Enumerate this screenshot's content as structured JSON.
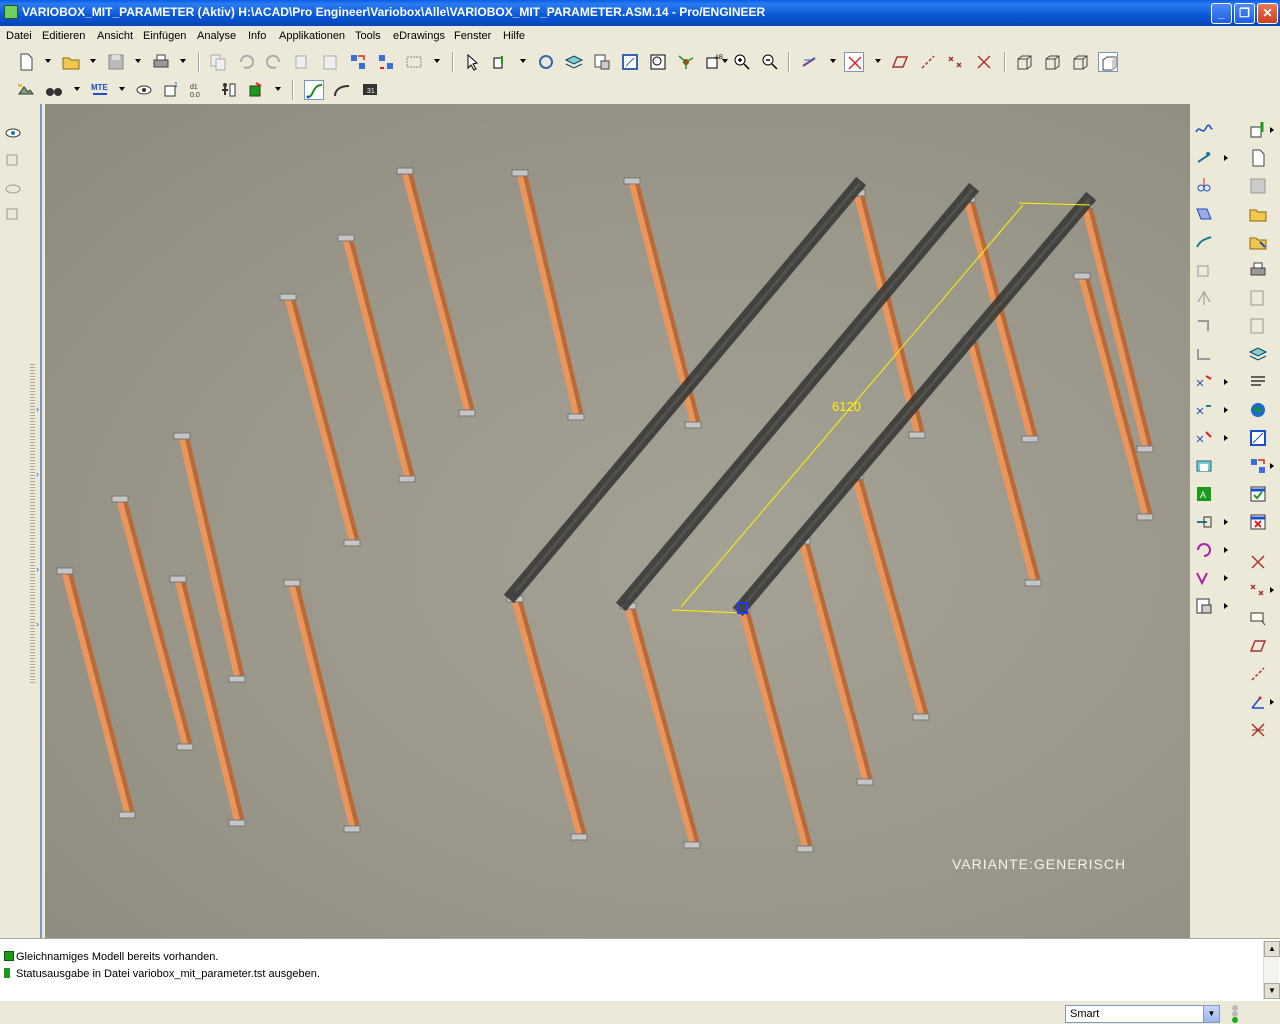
{
  "window": {
    "title": "VARIOBOX_MIT_PARAMETER (Aktiv) H:\\ACAD\\Pro Engineer\\Variobox\\Alle\\VARIOBOX_MIT_PARAMETER.ASM.14 - Pro/ENGINEER",
    "minimize": "_",
    "restore": "❐",
    "close": "✕"
  },
  "menu": [
    "Datei",
    "Editieren",
    "Ansicht",
    "Einfügen",
    "Analyse",
    "Info",
    "Applikationen",
    "Tools",
    "eDrawings",
    "Fenster",
    "Hilfe"
  ],
  "viewport": {
    "variant_label": "VARIANTE:GENERISCH",
    "dimension_value": "6120",
    "colors": {
      "column": "#e9955b",
      "column_shade": "#b86a38",
      "beam": "#3b3b38",
      "dimension": "#fff200"
    }
  },
  "messages": [
    {
      "icon": "info-icon",
      "text": "Gleichnamiges Modell bereits vorhanden."
    },
    {
      "icon": "arrow-right-icon",
      "text": "Statusausgabe in Datei variobox_mit_parameter.tst ausgeben."
    }
  ],
  "status": {
    "filter_value": "Smart"
  }
}
